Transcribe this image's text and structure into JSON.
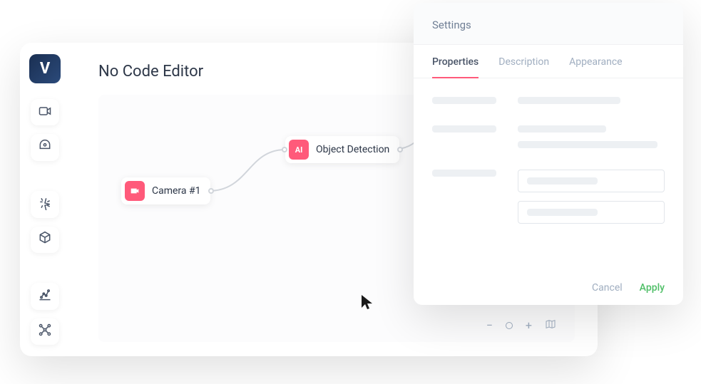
{
  "app": {
    "logo_text": "V",
    "title": "No Code Editor"
  },
  "sidebar": {
    "tools": [
      {
        "name": "camera-icon"
      },
      {
        "name": "target-icon"
      },
      {
        "name": "sparkle-icon"
      },
      {
        "name": "cube-icon"
      },
      {
        "name": "chart-icon"
      },
      {
        "name": "nodes-icon"
      }
    ]
  },
  "canvas": {
    "nodes": [
      {
        "id": "camera",
        "label": "Camera #1",
        "icon": "camera"
      },
      {
        "id": "ai",
        "label": "Object Detection",
        "icon": "AI"
      }
    ]
  },
  "zoom": {
    "out": "−",
    "in": "+"
  },
  "settings": {
    "title": "Settings",
    "tabs": [
      {
        "key": "properties",
        "label": "Properties",
        "active": true
      },
      {
        "key": "description",
        "label": "Description",
        "active": false
      },
      {
        "key": "appearance",
        "label": "Appearance",
        "active": false
      }
    ],
    "actions": {
      "cancel": "Cancel",
      "apply": "Apply"
    }
  }
}
